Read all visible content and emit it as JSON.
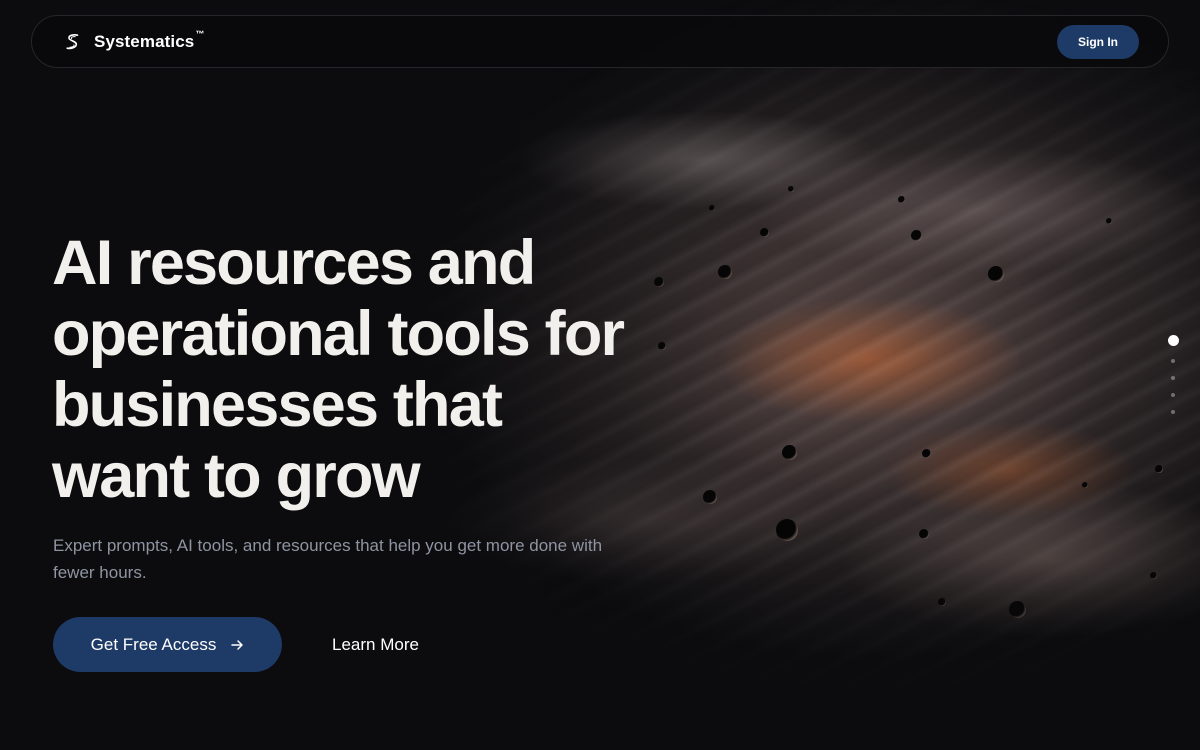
{
  "navbar": {
    "brand_name": "Systematics",
    "brand_tm": "™",
    "logo_icon": "s-logo-icon",
    "signin_label": "Sign In"
  },
  "hero": {
    "title_lines": [
      "AI resources and",
      "operational tools for",
      "businesses that",
      "want to grow"
    ],
    "subtitle_lines": [
      "Expert prompts, AI tools, and resources that help you get more done with",
      "fewer hours."
    ],
    "cta_primary_label": "Get Free Access",
    "cta_primary_icon": "arrow-right-icon",
    "cta_secondary_label": "Learn More"
  },
  "slides": {
    "count": 5,
    "active_index": 0
  },
  "colors": {
    "accent": "#1e3a66",
    "background": "#0c0c0e",
    "title": "#f2f0ec",
    "subtitle": "#8f94a2"
  }
}
